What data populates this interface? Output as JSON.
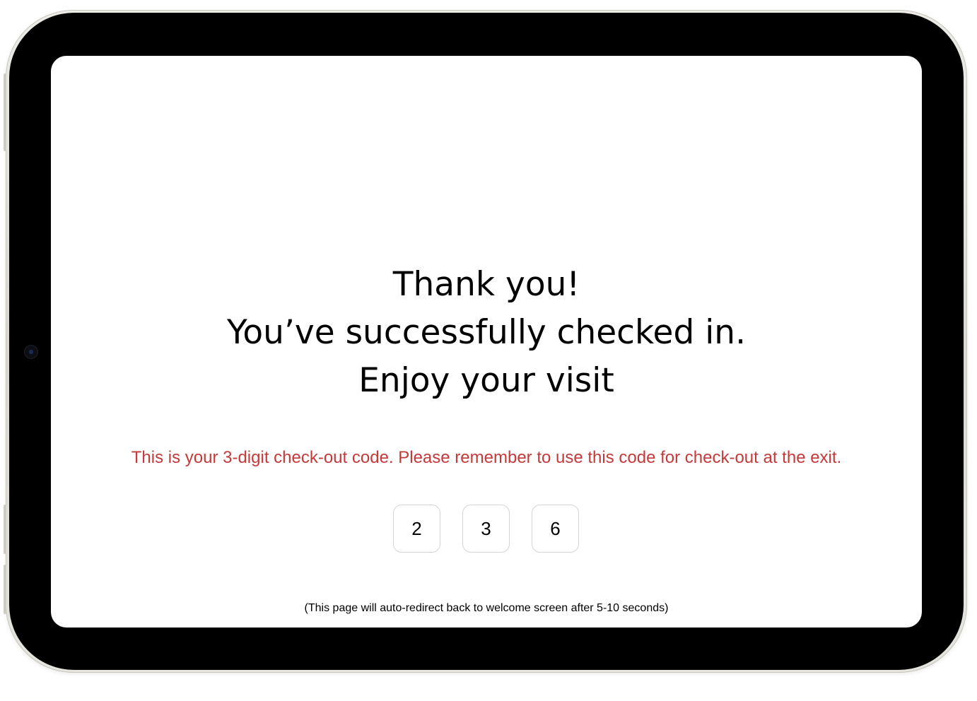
{
  "screen": {
    "headline": {
      "line1": "Thank you!",
      "line2": "You’ve successfully checked in.",
      "line3": "Enjoy your visit"
    },
    "notice": "This is your 3-digit check-out code. Please remember to use this code for check-out at the exit.",
    "code_digits": [
      "2",
      "3",
      "6"
    ],
    "footer_note": "(This page will auto-redirect back to welcome screen after 5-10 seconds)"
  },
  "colors": {
    "notice": "#c43a3a",
    "text": "#000000",
    "background": "#ffffff",
    "digit_border": "#d4d4d4"
  }
}
